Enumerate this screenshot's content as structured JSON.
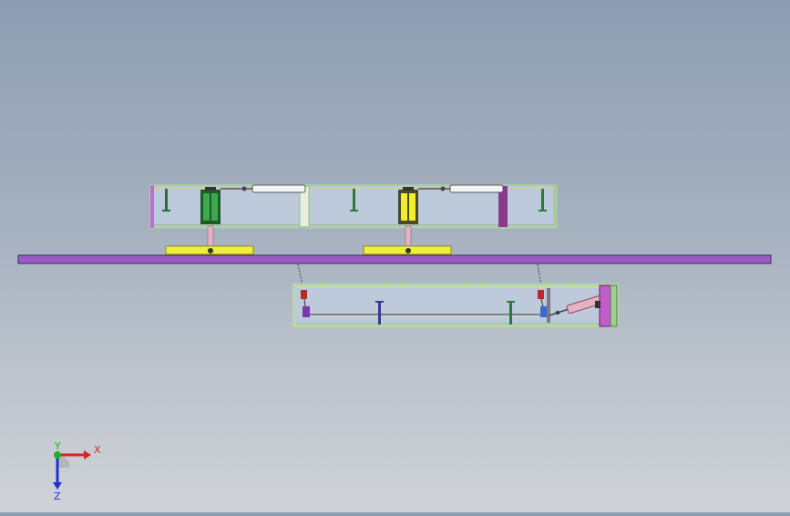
{
  "viewport": {
    "background_top": "#8e9db2",
    "background_bottom": "#cfd3d8"
  },
  "colors": {
    "frame_edge": "#a9c9a6",
    "frame_fill": "#bccadb",
    "frame_end_left": "#c66ad6",
    "beam": "#9a5cc4",
    "beam_edge": "#3a2a55",
    "pad": "#f1ee3a",
    "green_carriage": "#3fa84f",
    "yellow_carriage": "#f2ee2c",
    "post_green": "#2d7a3a",
    "post_purple": "#9a3d98",
    "lower_frame_edge": "#b7da98",
    "cylinder": "#e6b2c2",
    "end_plate": "#c25cc8"
  },
  "triad": {
    "x_label": "X",
    "y_label": "Y",
    "z_label": "Z",
    "x_color": "#e02020",
    "y_color": "#20b020",
    "z_color": "#2030d0"
  }
}
